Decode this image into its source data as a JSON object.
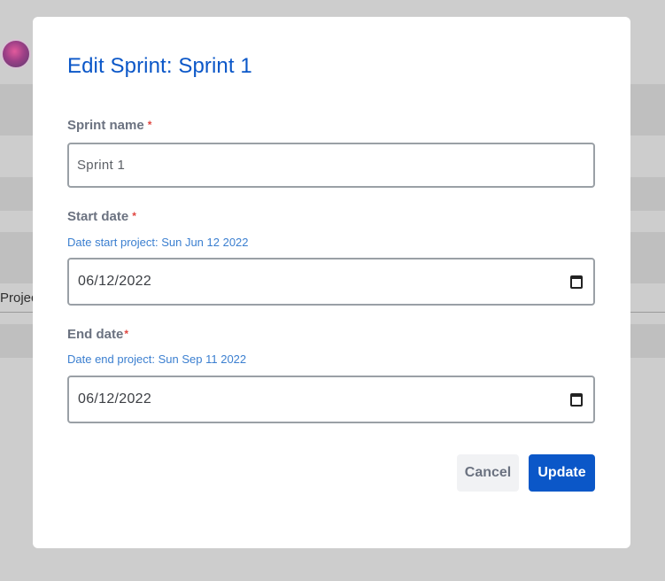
{
  "background": {
    "partial_text": "Projec"
  },
  "modal": {
    "title": "Edit Sprint: Sprint 1",
    "sprint_name": {
      "label": "Sprint name",
      "required_mark": "*",
      "value": "Sprint 1"
    },
    "start_date": {
      "label": "Start date",
      "required_mark": "*",
      "hint": "Date start project: Sun Jun 12 2022",
      "value": "06/12/2022",
      "icon": "calendar-icon"
    },
    "end_date": {
      "label": "End date",
      "required_mark": "*",
      "hint": "Date end project: Sun Sep 11 2022",
      "value": "06/12/2022",
      "icon": "calendar-icon"
    },
    "buttons": {
      "cancel": "Cancel",
      "update": "Update"
    }
  },
  "colors": {
    "accent": "#0b57c8",
    "required": "#e0453f",
    "hint": "#3b7fd0",
    "overlay": "#cdcdcd"
  }
}
